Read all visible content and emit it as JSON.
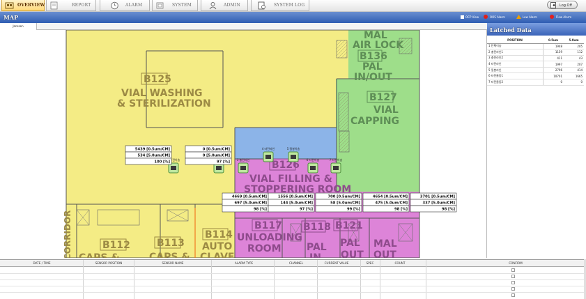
{
  "nav": {
    "tabs": [
      {
        "label": "OVERVIEW",
        "icon": "home-icon",
        "active": true
      },
      {
        "label": "REPORT",
        "icon": "report-icon",
        "active": false
      },
      {
        "label": "ALARM",
        "icon": "clock-icon",
        "active": false
      },
      {
        "label": "SYSTEM",
        "icon": "system-icon",
        "active": false
      },
      {
        "label": "ADMIN",
        "icon": "admin-user-icon",
        "active": false
      },
      {
        "label": "SYSTEM LOG",
        "icon": "log-icon",
        "active": false
      }
    ],
    "logoff_label": "Log Off"
  },
  "subbar": {
    "title": "MAP",
    "ocp_view_label": "OCP View",
    "legend": [
      {
        "label": "OOS Alarm",
        "color": "#e0201a"
      },
      {
        "label": "Low Alarm",
        "color": "#f0a000"
      },
      {
        "label": "Flow Alarm",
        "color": "#e02020"
      }
    ]
  },
  "room_tab": "Janssen",
  "map": {
    "rooms": [
      {
        "code": "B125",
        "name_lines": [
          "VIAL WASHING",
          "& STERILIZATION"
        ]
      },
      {
        "code": "B136",
        "name_lines": [
          "PAL",
          "IN/OUT"
        ],
        "extra": [
          "MAL",
          "AIR LOCK"
        ]
      },
      {
        "code": "B127",
        "name_lines": [
          "VIAL",
          "CAPPING"
        ]
      },
      {
        "code": "B126",
        "name_lines": [
          "VIAL FILLING &",
          "STOPPERING ROOM"
        ]
      },
      {
        "code": "B117",
        "name_lines": [
          "UNLOADING",
          "ROOM"
        ]
      },
      {
        "code": "B118",
        "name_lines": [
          "PAL",
          "IN"
        ]
      },
      {
        "code": "B121",
        "name_lines": [
          "PAL",
          "OUT"
        ]
      },
      {
        "code": "B114",
        "name_lines": [
          "AUTO",
          "CLAVE"
        ]
      },
      {
        "code": "B113",
        "name_lines": [
          "CAPS &"
        ]
      },
      {
        "code": "B112",
        "name_lines": [
          "CAPS &"
        ]
      },
      {
        "code": "",
        "name_lines": [
          "MAL",
          "OUT"
        ]
      },
      {
        "code": "",
        "name_lines": [
          "CORRIDOR"
        ]
      }
    ],
    "sensors": [
      {
        "label": "1 충전이송"
      },
      {
        "label": "2 충전라인"
      },
      {
        "label": "3 충전라인"
      },
      {
        "label": "4 타전라인"
      },
      {
        "label": "5 밀봉이송"
      },
      {
        "label": "6 타전이송"
      },
      {
        "label": "7 타전이송"
      }
    ],
    "readings": [
      {
        "r1": "5439 [0.5um/CM]",
        "r2": "534 [5.0um/CM]",
        "r3": "100 [%]"
      },
      {
        "r1": "0 [0.5um/CM]",
        "r2": "0 [5.0um/CM]",
        "r3": "97 [%]"
      },
      {
        "r1": "4669 [0.5um/CM]",
        "r2": "697 [5.0um/CM]",
        "r3": "98 [%]"
      },
      {
        "r1": "1556 [0.5um/CM]",
        "r2": "144 [5.0um/CM]",
        "r3": "97 [%]"
      },
      {
        "r1": "700 [0.5um/CM]",
        "r2": "58 [5.0um/CM]",
        "r3": "99 [%]"
      },
      {
        "r1": "4654 [0.5um/CM]",
        "r2": "475 [5.0um/CM]",
        "r3": "98 [%]"
      },
      {
        "r1": "3701 [0.5um/CM]",
        "r2": "337 [5.0um/CM]",
        "r3": "98 [%]"
      }
    ]
  },
  "latched": {
    "title": "Latched Data",
    "headers": [
      "POSITION",
      "0.5um",
      "5.0um"
    ],
    "rows": [
      {
        "pos": "1 탄팩이송",
        "a": "1948",
        "b": "205"
      },
      {
        "pos": "2 충전라인1",
        "a": "1159",
        "b": "112"
      },
      {
        "pos": "3 충전라인2",
        "a": "411",
        "b": "43"
      },
      {
        "pos": "4 타전라인",
        "a": "1997",
        "b": "207"
      },
      {
        "pos": "5 밀봉라인",
        "a": "2796",
        "b": "414"
      },
      {
        "pos": "6 타전물동1",
        "a": "10701",
        "b": "1665"
      },
      {
        "pos": "7 타전물동2",
        "a": "0",
        "b": "0"
      }
    ]
  },
  "alarm_table": {
    "headers": [
      "DATE / TIME",
      "SENSOR POSITION",
      "SENSOR NAME",
      "ALARM TYPE",
      "CHANNEL",
      "CURRENT VALUE",
      "SPEC",
      "COUNT",
      "CONFIRM"
    ]
  }
}
